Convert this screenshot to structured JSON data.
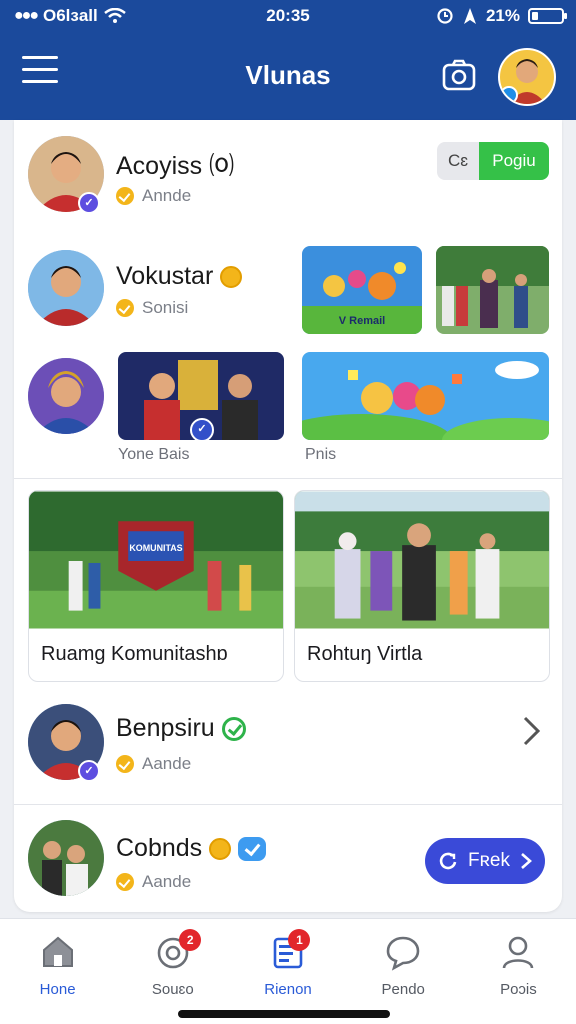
{
  "status_bar": {
    "carrier": "O6lɜall",
    "time": "20:35",
    "battery": "21%",
    "battery_level": 0.21
  },
  "header": {
    "title": "Vlunas"
  },
  "rows": [
    {
      "name": "Acoyiss ⒪",
      "sub": "Annde",
      "actions": {
        "secondary": "Cɛ",
        "primary": "Poɡiu"
      }
    },
    {
      "name": "Vokustar",
      "sub": "Sonisi"
    },
    {
      "captions": [
        "Yone Bais",
        "Pnis"
      ]
    }
  ],
  "thumbnails": {
    "game_art_text": "V Remail"
  },
  "featured": [
    {
      "label": "Ruamg Komunitashɒ",
      "banner_text": "KOMUNITAS"
    },
    {
      "label": "Rohtuŋ Virtla"
    }
  ],
  "list2": [
    {
      "name": "Benpsiru",
      "sub": "Aande"
    },
    {
      "name": "Cobnds",
      "sub": "Aande",
      "action": "Fʀek"
    }
  ],
  "nav": [
    {
      "label": "Hone",
      "icon": "home-icon",
      "badge": ""
    },
    {
      "label": "Souɛo",
      "icon": "search-icon",
      "badge": "2"
    },
    {
      "label": "Rienon",
      "icon": "clipboard-icon",
      "badge": "1"
    },
    {
      "label": "Pendo",
      "icon": "chat-bubble-icon",
      "badge": ""
    },
    {
      "label": "Poɔis",
      "icon": "profile-icon",
      "badge": ""
    }
  ],
  "colors": {
    "appbar": "#1b4a9c",
    "accent_green": "#35c148",
    "accent_blue": "#3a4ad8",
    "badge_red": "#e2262b",
    "coin_gold": "#f3b51a"
  }
}
